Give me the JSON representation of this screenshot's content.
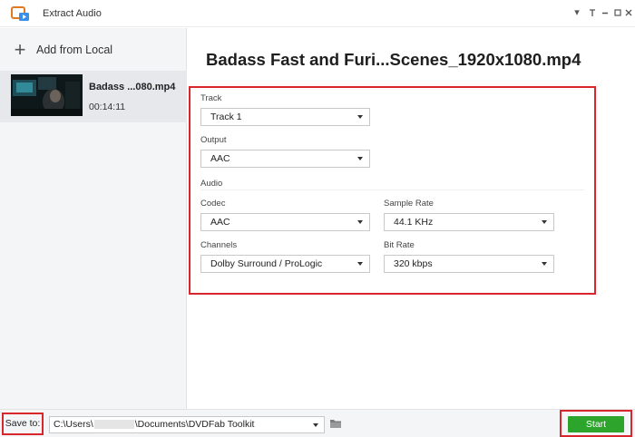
{
  "window": {
    "title": "Extract Audio",
    "controls": [
      "dropdown-icon",
      "pin-icon",
      "minimize-icon",
      "maximize-icon",
      "close-icon"
    ]
  },
  "sidebar": {
    "add_label": "Add from Local",
    "files": [
      {
        "name": "Badass ...080.mp4",
        "duration": "00:14:11"
      }
    ]
  },
  "main": {
    "title": "Badass Fast and Furi...Scenes_1920x1080.mp4",
    "track": {
      "label": "Track",
      "value": "Track 1"
    },
    "output": {
      "label": "Output",
      "value": "AAC"
    },
    "audio_section": "Audio",
    "codec": {
      "label": "Codec",
      "value": "AAC"
    },
    "sample_rate": {
      "label": "Sample Rate",
      "value": "44.1 KHz"
    },
    "channels": {
      "label": "Channels",
      "value": "Dolby Surround / ProLogic"
    },
    "bit_rate": {
      "label": "Bit Rate",
      "value": "320 kbps"
    }
  },
  "bottom": {
    "save_to_label": "Save to:",
    "path_prefix": "C:\\Users\\",
    "path_suffix": "\\Documents\\DVDFab Toolkit",
    "start_label": "Start"
  },
  "colors": {
    "highlight": "#d9262c",
    "start_button": "#2da52d",
    "sidebar_bg": "#f4f5f7",
    "selected_item_bg": "#e6e8ec"
  }
}
